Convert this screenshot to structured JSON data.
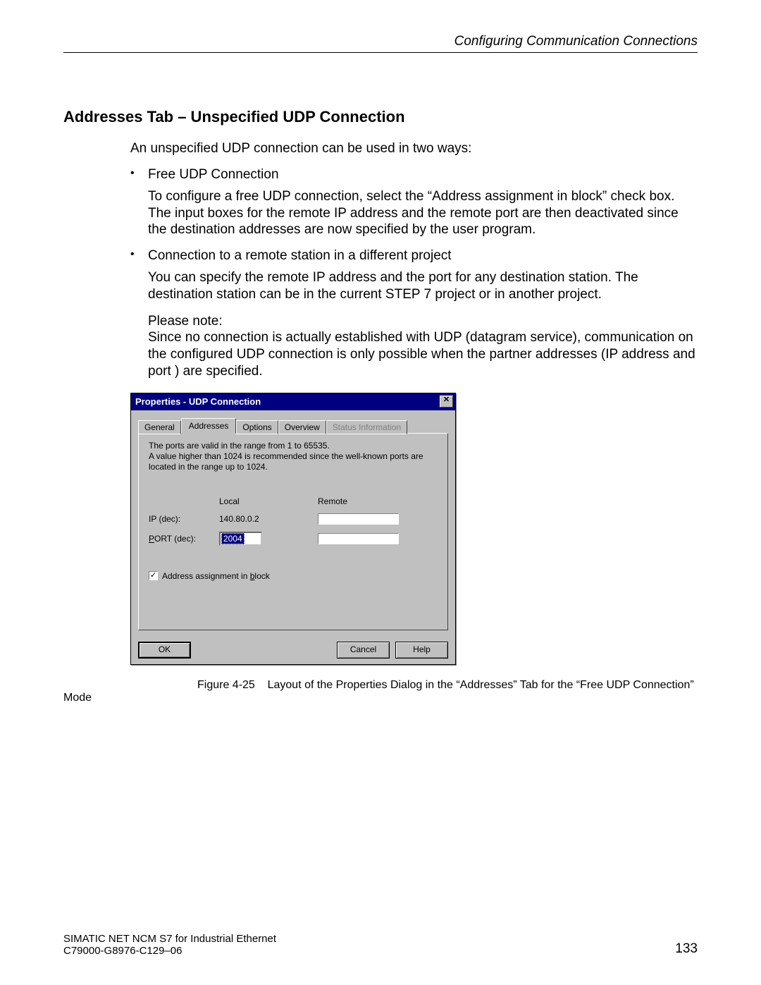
{
  "header": {
    "chapter": "Configuring Communication Connections"
  },
  "section": {
    "title": "Addresses Tab – Unspecified UDP Connection"
  },
  "intro": "An unspecified UDP connection can be used in two ways:",
  "bullets": [
    {
      "label": "Free UDP Connection",
      "para": "To configure a free UDP connection, select the “Address assignment in block” check box. The input boxes for the remote IP address and the remote port are then deactivated since the destination addresses are now specified by the user program."
    },
    {
      "label": "Connection to a remote station in a different project",
      "para": "You can specify the remote IP address and the port for any destination station. The destination station can be in the current STEP 7 project or in another project.",
      "note_label": "Please note:",
      "note": "Since no connection is actually established with UDP (datagram service), communication on the configured UDP connection is only possible when the partner addresses (IP address and port ) are specified."
    }
  ],
  "dialog": {
    "title": "Properties - UDP Connection",
    "tabs": {
      "general": "General",
      "addresses": "Addresses",
      "options": "Options",
      "overview": "Overview",
      "status": "Status Information"
    },
    "help1": "The ports are valid in the range from 1 to 65535.",
    "help2": "A value higher than 1024 is recommended since the well-known ports are located in the range up to 1024.",
    "col_local": "Local",
    "col_remote": "Remote",
    "row_ip": "IP (dec):",
    "row_port_pref": "P",
    "row_port_rest": "ORT (dec):",
    "local_ip": "140.80.0.2",
    "local_port": "2004",
    "remote_ip": "",
    "remote_port": "",
    "checkbox_pref": "Address assignment in ",
    "checkbox_ul": "b",
    "checkbox_rest": "lock",
    "buttons": {
      "ok": "OK",
      "cancel": "Cancel",
      "help": "Help"
    }
  },
  "figure": {
    "label": "Figure 4-25",
    "caption": "Layout of the Properties Dialog in the “Addresses” Tab for the “Free UDP Connection” Mode"
  },
  "footer": {
    "line1": "SIMATIC NET NCM S7 for Industrial Ethernet",
    "line2": "C79000-G8976-C129–06",
    "page": "133"
  }
}
